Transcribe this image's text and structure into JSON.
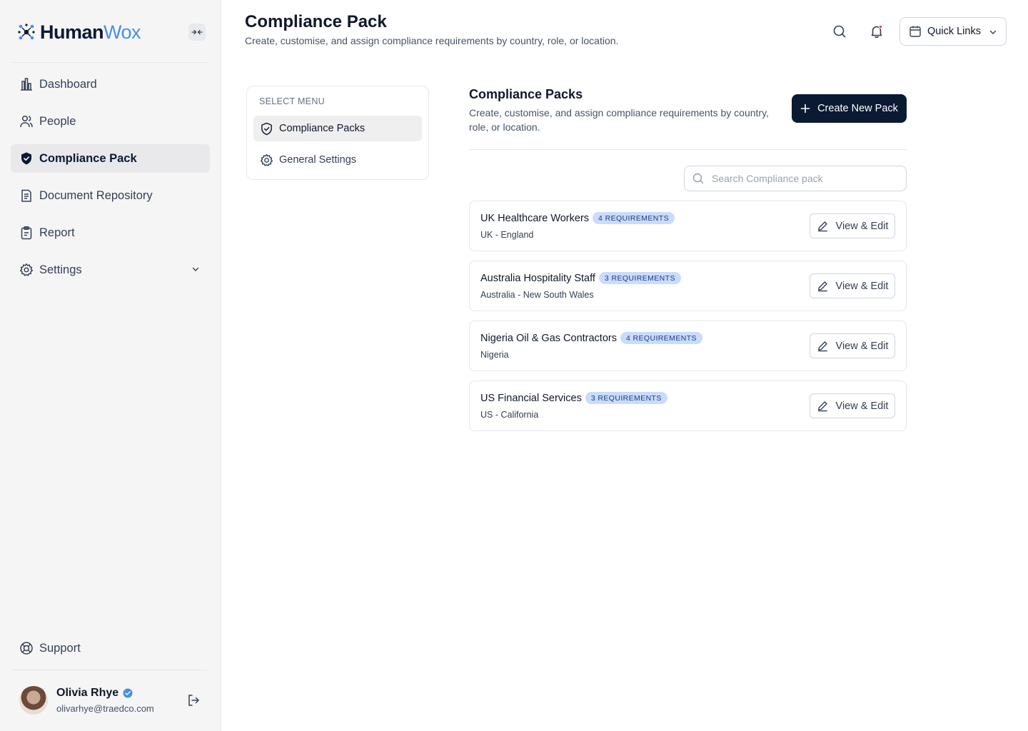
{
  "brand": {
    "name_part1": "Human",
    "name_part2": "Wox"
  },
  "sidebar": {
    "items": [
      {
        "label": "Dashboard",
        "icon": "bar-chart-icon",
        "active": false
      },
      {
        "label": "People",
        "icon": "users-icon",
        "active": false
      },
      {
        "label": "Compliance Pack",
        "icon": "shield-icon",
        "active": true
      },
      {
        "label": "Document Repository",
        "icon": "document-icon",
        "active": false
      },
      {
        "label": "Report",
        "icon": "clipboard-icon",
        "active": false
      },
      {
        "label": "Settings",
        "icon": "gear-icon",
        "active": false,
        "expandable": true
      }
    ],
    "support_label": "Support",
    "user": {
      "name": "Olivia Rhye",
      "email": "olivarhye@traedco.com",
      "verified": true
    }
  },
  "header": {
    "title": "Compliance Pack",
    "subtitle": "Create, customise, and assign compliance requirements by country, role, or location.",
    "quick_links_label": "Quick Links",
    "notification_dot_color": "#e5484d"
  },
  "select_menu": {
    "label": "SELECT MENU",
    "items": [
      {
        "label": "Compliance Packs",
        "icon": "shield-check-icon",
        "active": true
      },
      {
        "label": "General Settings",
        "icon": "gear-icon",
        "active": false
      }
    ]
  },
  "main": {
    "title": "Compliance Packs",
    "subtitle": "Create, customise, and assign compliance requirements by country, role, or location.",
    "create_button_label": "Create New Pack",
    "search_placeholder": "Search Compliance pack",
    "search_value": "",
    "edit_button_label": "View & Edit",
    "packs": [
      {
        "name": "UK Healthcare Workers",
        "badge": "4 REQUIREMENTS",
        "location": "UK - England"
      },
      {
        "name": "Australia Hospitality Staff",
        "badge": "3 REQUIREMENTS",
        "location": "Australia - New South Wales"
      },
      {
        "name": "Nigeria Oil & Gas Contractors",
        "badge": "4 REQUIREMENTS",
        "location": "Nigeria"
      },
      {
        "name": "US Financial Services",
        "badge": "3 REQUIREMENTS",
        "location": "US - California"
      }
    ]
  },
  "colors": {
    "primary": "#0b1a33",
    "brand_accent": "#4a8fe0",
    "badge_bg": "#c9dcfa",
    "badge_text": "#1e3a8a",
    "sidebar_bg": "#f5f5f6"
  }
}
